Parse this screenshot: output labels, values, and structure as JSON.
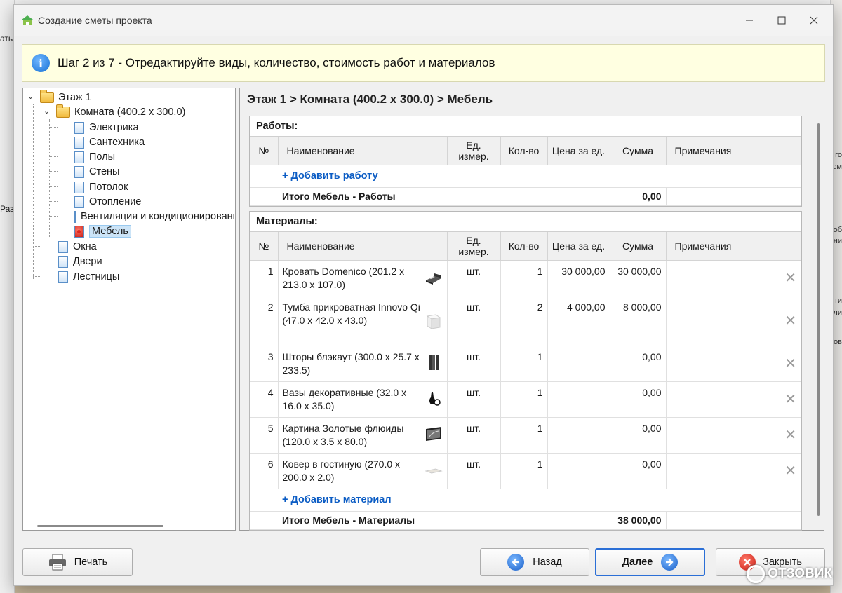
{
  "window": {
    "title": "Создание сметы проекта"
  },
  "background": {
    "left_text_1": "ать",
    "left_text_2": "Раз",
    "right_texts": [
      "го",
      "ом",
      "об",
      "ни",
      "ети",
      "ли",
      "ов"
    ]
  },
  "banner": {
    "text": "Шаг 2 из 7 - Отредактируйте виды, количество, стоимость работ и материалов"
  },
  "tree": {
    "floor": "Этаж 1",
    "room": "Комната (400.2 x 300.0)",
    "room_items": [
      "Электрика",
      "Сантехника",
      "Полы",
      "Стены",
      "Потолок",
      "Отопление",
      "Вентиляция и кондиционирование",
      "Мебель"
    ],
    "floor_items": [
      "Окна",
      "Двери",
      "Лестницы"
    ],
    "selected": "Мебель"
  },
  "breadcrumb": "Этаж 1 > Комната (400.2 x 300.0) > Мебель",
  "columns": {
    "no": "№",
    "name": "Наименование",
    "unit": "Ед. измер.",
    "qty": "Кол-во",
    "price": "Цена за ед.",
    "sum": "Сумма",
    "notes": "Примечания"
  },
  "works": {
    "title": "Работы:",
    "add_label": "+ Добавить работу",
    "total_label": "Итого Мебель - Работы",
    "total_value": "0,00"
  },
  "materials": {
    "title": "Материалы:",
    "add_label": "+ Добавить материал",
    "total_label": "Итого Мебель - Материалы",
    "total_value": "38 000,00",
    "rows": [
      {
        "no": "1",
        "name": "Кровать Domenico (201.2 x 213.0 x 107.0)",
        "unit": "шт.",
        "qty": "1",
        "price": "30 000,00",
        "sum": "30 000,00",
        "thumb": "bed-thumb"
      },
      {
        "no": "2",
        "name": "Тумба прикроватная Innovo Qi (47.0 x 42.0 x 43.0)",
        "unit": "шт.",
        "qty": "2",
        "price": "4 000,00",
        "sum": "8 000,00",
        "thumb": "nightstand-thumb"
      },
      {
        "no": "3",
        "name": "Шторы блэкаут (300.0 x 25.7 x 233.5)",
        "unit": "шт.",
        "qty": "1",
        "price": "",
        "sum": "0,00",
        "thumb": "curtains-thumb"
      },
      {
        "no": "4",
        "name": "Вазы декоративные (32.0 x 16.0 x 35.0)",
        "unit": "шт.",
        "qty": "1",
        "price": "",
        "sum": "0,00",
        "thumb": "vases-thumb"
      },
      {
        "no": "5",
        "name": "Картина Золотые флюиды (120.0 x 3.5 x 80.0)",
        "unit": "шт.",
        "qty": "1",
        "price": "",
        "sum": "0,00",
        "thumb": "painting-thumb"
      },
      {
        "no": "6",
        "name": "Ковер в гостиную (270.0 x 200.0 x 2.0)",
        "unit": "шт.",
        "qty": "1",
        "price": "",
        "sum": "0,00",
        "thumb": "carpet-thumb"
      }
    ]
  },
  "buttons": {
    "print": "Печать",
    "back": "Назад",
    "next": "Далее",
    "close": "Закрыть"
  },
  "watermark": "ОТЗОВИК"
}
